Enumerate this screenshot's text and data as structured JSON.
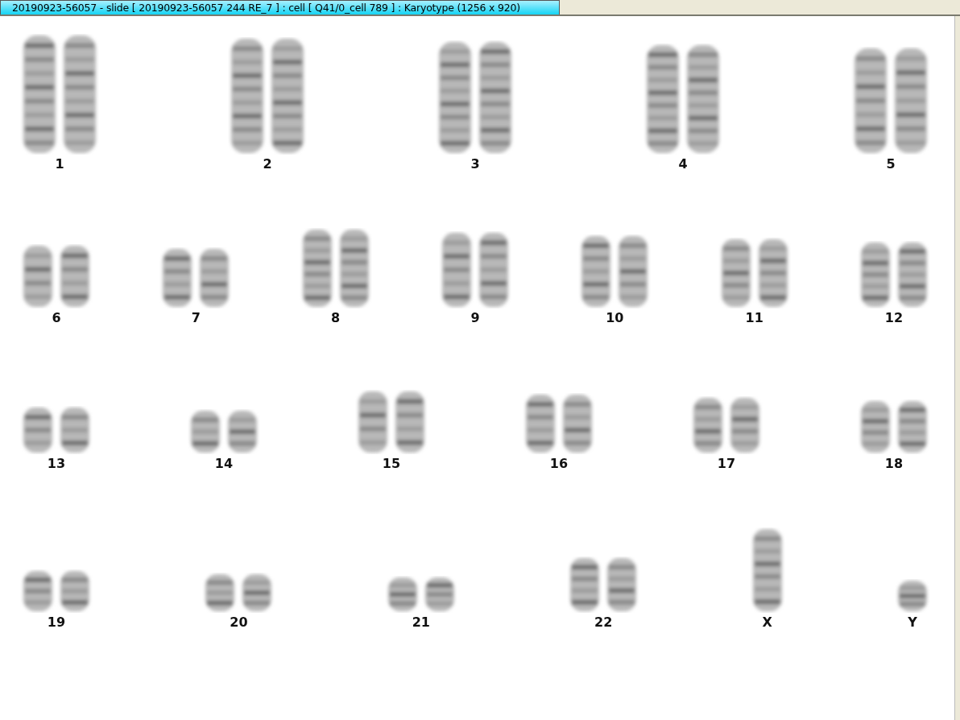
{
  "window": {
    "title": "20190923-56057 - slide [ 20190923-56057 244 RE_7 ] : cell [ Q41/0_cell 789 ] : Karyotype  (1256 x 920)"
  },
  "karyotype": {
    "rows": [
      {
        "groups": [
          {
            "label": "1",
            "kind": "pair"
          },
          {
            "label": "2",
            "kind": "pair"
          },
          {
            "label": "3",
            "kind": "pair"
          },
          {
            "label": "4",
            "kind": "pair"
          },
          {
            "label": "5",
            "kind": "pair"
          }
        ]
      },
      {
        "groups": [
          {
            "label": "6",
            "kind": "pair"
          },
          {
            "label": "7",
            "kind": "pair"
          },
          {
            "label": "8",
            "kind": "pair"
          },
          {
            "label": "9",
            "kind": "pair"
          },
          {
            "label": "10",
            "kind": "pair"
          },
          {
            "label": "11",
            "kind": "pair"
          },
          {
            "label": "12",
            "kind": "pair"
          }
        ]
      },
      {
        "groups": [
          {
            "label": "13",
            "kind": "pair"
          },
          {
            "label": "14",
            "kind": "pair"
          },
          {
            "label": "15",
            "kind": "pair"
          },
          {
            "label": "16",
            "kind": "pair"
          },
          {
            "label": "17",
            "kind": "pair"
          },
          {
            "label": "18",
            "kind": "pair"
          }
        ]
      },
      {
        "groups": [
          {
            "label": "19",
            "kind": "pair"
          },
          {
            "label": "20",
            "kind": "pair"
          },
          {
            "label": "21",
            "kind": "pair"
          },
          {
            "label": "22",
            "kind": "pair"
          },
          {
            "label": "X",
            "kind": "single"
          },
          {
            "label": "Y",
            "kind": "single"
          }
        ]
      }
    ]
  }
}
